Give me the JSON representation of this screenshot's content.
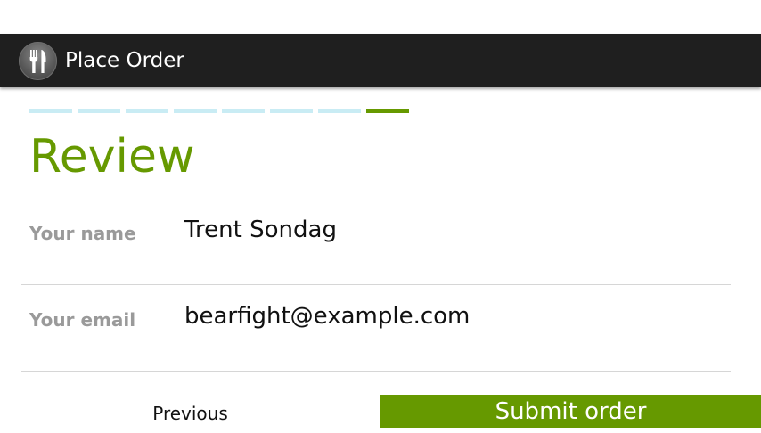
{
  "action_bar": {
    "title": "Place Order",
    "icon": "fork-knife-icon",
    "background": "#1f1f1f"
  },
  "progress": {
    "total_steps": 8,
    "current_step": 8,
    "inactive_color": "#c9ecf4",
    "active_color": "#669900"
  },
  "review": {
    "title": "Review",
    "fields": [
      {
        "label": "Your name",
        "value": "Trent Sondag"
      },
      {
        "label": "Your email",
        "value": "bearfight@example.com"
      }
    ]
  },
  "buttons": {
    "previous_label": "Previous",
    "submit_label": "Submit order"
  },
  "colors": {
    "accent": "#669900"
  }
}
